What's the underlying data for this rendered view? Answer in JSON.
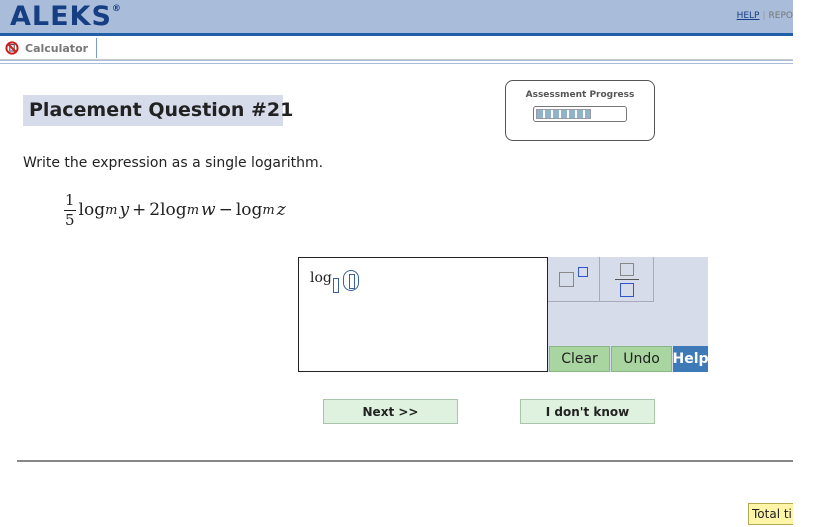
{
  "header": {
    "logo_text": "ALEKS",
    "logo_mark": "®",
    "help_link": "HELP",
    "separator": "|",
    "report_link": "REPO"
  },
  "toolbar": {
    "calculator_label": "Calculator",
    "calculator_icon": "no-sign-icon"
  },
  "question": {
    "title": "Placement Question #21",
    "instruction": "Write the expression as a single logarithm.",
    "expression": {
      "fraction_numerator": "1",
      "fraction_denominator": "5",
      "log": "log",
      "base": "m",
      "var1": "y",
      "plus": "+",
      "coef2": "2",
      "var2": "w",
      "minus": "−",
      "var3": "z"
    }
  },
  "progress": {
    "label": "Assessment Progress",
    "filled_fraction": 0.62
  },
  "answer": {
    "log_text": "log"
  },
  "tools": {
    "superscript_icon": "superscript-template-icon",
    "fraction_icon": "fraction-template-icon",
    "clear_label": "Clear",
    "undo_label": "Undo",
    "help_label": "Help"
  },
  "nav": {
    "next_label": "Next >>",
    "idk_label": "I don't know"
  },
  "footer": {
    "total_time_label": "Total ti"
  },
  "colors": {
    "header_bg": "#a9bcd9",
    "brand": "#163e82",
    "title_bg": "#d6dcea",
    "tool_green": "#a8d5a0",
    "help_blue": "#3e7ab8",
    "nav_green": "#dff2df",
    "timer_yellow": "#fff5a8"
  }
}
